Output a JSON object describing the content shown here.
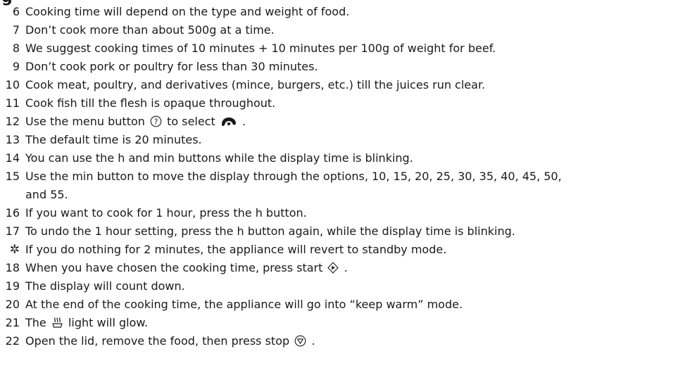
{
  "heading_fragment": "g",
  "steps": [
    {
      "number": "6",
      "text": "Cooking time will depend on the type and weight of food."
    },
    {
      "number": "7",
      "text": "Don’t cook more than about 500g at a time."
    },
    {
      "number": "8",
      "text": "We suggest cooking times of 10 minutes + 10 minutes per 100g of weight for beef."
    },
    {
      "number": "9",
      "text": "Don’t cook pork or poultry for less than 30 minutes."
    },
    {
      "number": "10",
      "text": "Cook meat, poultry, and derivatives (mince, burgers, etc.) till the juices run clear."
    },
    {
      "number": "11",
      "text": "Cook fish till the flesh is opaque throughout."
    },
    {
      "number": "12",
      "before": "Use the menu button",
      "middle": "to select",
      "after": ".",
      "icon_a": "menu-button-icon",
      "icon_b": "roast-program-icon"
    },
    {
      "number": "13",
      "text": "The default time is 20 minutes."
    },
    {
      "number": "14",
      "text": "You can use the h and min buttons while the display time is blinking."
    },
    {
      "number": "15",
      "text": "Use the min button to move the display through the options, 10, 15, 20, 25, 30, 35, 40, 45, 50,",
      "continuation": "and 55."
    },
    {
      "number": "16",
      "text": "If you want to cook for 1 hour, press the h button."
    },
    {
      "number": "17",
      "text": "To undo the 1 hour setting, press the h button again, while the display time is blinking."
    },
    {
      "marker": "✲",
      "marker_icon": "tip-star-icon",
      "text": "If you do nothing for 2 minutes, the appliance will revert to standby mode."
    },
    {
      "number": "18",
      "before": "When you have chosen the cooking time, press start",
      "after": ".",
      "icon": "start-button-icon"
    },
    {
      "number": "19",
      "text": "The display will count down."
    },
    {
      "number": "20",
      "text": "At the end of the cooking time, the appliance will go into “keep warm” mode."
    },
    {
      "number": "21",
      "before": "The",
      "after": "light will glow.",
      "icon": "keep-warm-light-icon"
    },
    {
      "number": "22",
      "before": "Open the lid, remove the food, then press stop",
      "after": ".",
      "icon": "stop-button-icon"
    }
  ]
}
